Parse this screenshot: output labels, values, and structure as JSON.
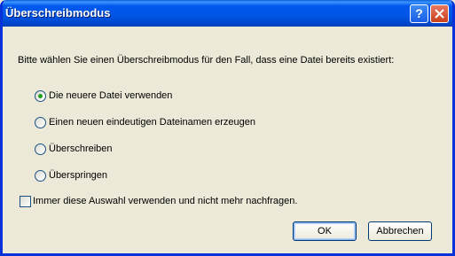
{
  "window": {
    "title": "Überschreibmodus"
  },
  "dialog": {
    "prompt": "Bitte wählen Sie einen Überschreibmodus für den Fall, dass eine Datei bereits existiert:",
    "options": [
      {
        "label": "Die neuere Datei verwenden",
        "selected": true
      },
      {
        "label": "Einen neuen eindeutigen Dateinamen erzeugen",
        "selected": false
      },
      {
        "label": "Überschreiben",
        "selected": false
      },
      {
        "label": "Überspringen",
        "selected": false
      }
    ],
    "remember_label": "Immer diese Auswahl verwenden und nicht mehr nachfragen.",
    "remember_checked": false
  },
  "buttons": {
    "ok": "OK",
    "cancel": "Abbrechen",
    "help": "?"
  }
}
